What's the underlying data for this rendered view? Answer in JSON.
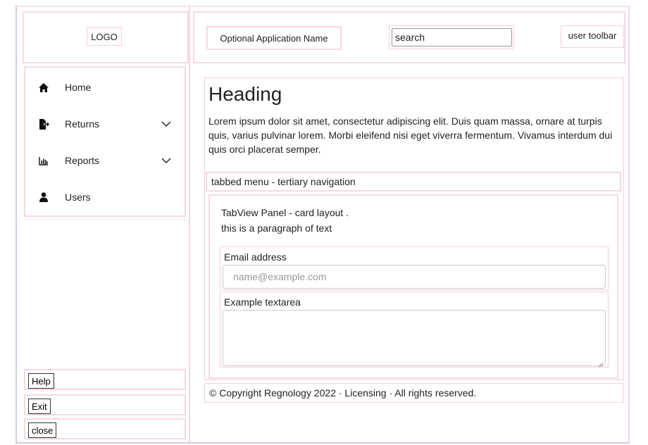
{
  "sidebar": {
    "logo": "LOGO",
    "items": [
      {
        "label": "Home",
        "icon": "home-icon"
      },
      {
        "label": "Returns",
        "icon": "file-export-icon"
      },
      {
        "label": "Reports",
        "icon": "bar-chart-icon"
      },
      {
        "label": "Users",
        "icon": "user-icon"
      }
    ],
    "buttons": {
      "help": "Help",
      "exit": "Exit",
      "close": "close"
    }
  },
  "header": {
    "app_name": "Optional Application Name",
    "search_value": "search",
    "user_toolbar": "user toolbar"
  },
  "main": {
    "heading": "Heading",
    "paragraph": "Lorem ipsum dolor sit amet, consectetur adipiscing elit. Duis quam massa, ornare at turpis quis, varius pulvinar lorem. Morbi eleifend nisi eget viverra fermentum. Vivamus interdum dui quis orci placerat semper.",
    "tabbed_menu": "tabbed menu - tertiary navigation",
    "panel": {
      "title": "TabView Panel - card layout .",
      "text": "this is a paragraph of text",
      "email_label": "Email address",
      "email_placeholder": "name@example.com",
      "textarea_label": "Example textarea"
    }
  },
  "footer": {
    "text": "© Copyright Regnology 2022 · Licensing · All rights reserved."
  },
  "colors": {
    "outline_pink": "#f3cfe0",
    "frame_purple": "#d9c9e3"
  }
}
